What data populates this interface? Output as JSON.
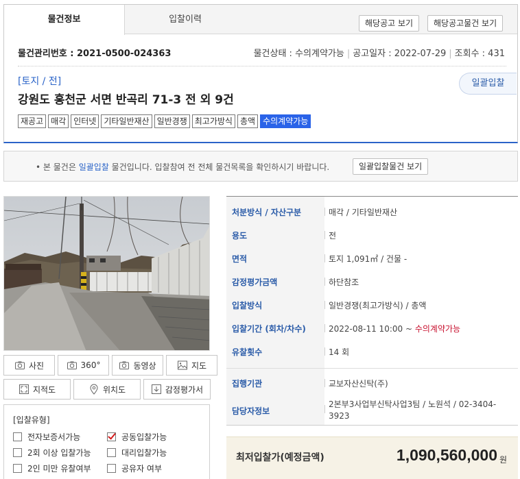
{
  "tabs": [
    {
      "label": "물건정보",
      "active": true
    },
    {
      "label": "입찰이력",
      "active": false
    }
  ],
  "header_buttons": {
    "notice_view": "해당공고 보기",
    "notice_items_view": "해당공고물건 보기"
  },
  "info": {
    "mgmt_number": "물건관리번호 : 2021-0500-024363",
    "status": "물건상태 : 수의계약가능",
    "notice_date": "공고일자 : 2022-07-29",
    "views": "조회수 : 431"
  },
  "category": "[토지 / 전]",
  "address": "강원도 홍천군 서면 반곡리 71-3 전 외 9건",
  "bulk_pill": "일괄입찰",
  "tags": [
    "재공고",
    "매각",
    "인터넷",
    "기타일반재산",
    "일반경쟁",
    "최고가방식",
    "총액",
    "수의계약가능"
  ],
  "highlight_tag": "수의계약가능",
  "notice": {
    "prefix": "• 본 물건은 ",
    "link": "일괄입찰",
    "suffix": " 물건입니다. 입찰참여 전 전체 물건목록을 확인하시기 바랍니다.",
    "button": "일괄입찰물건 보기"
  },
  "tools": {
    "photo": "사진",
    "view360": "360°",
    "video": "동영상",
    "map": "지도",
    "cadastral": "지적도",
    "location": "위치도",
    "appraisal": "감정평가서"
  },
  "bid_type": {
    "title": "[입찰유형]",
    "items": [
      {
        "label": "전자보증서가능",
        "checked": false
      },
      {
        "label": "공동입찰가능",
        "checked": true
      },
      {
        "label": "2회 이상 입찰가능",
        "checked": false
      },
      {
        "label": "대리입찰가능",
        "checked": false
      },
      {
        "label": "2인 미만 유찰여부",
        "checked": false
      },
      {
        "label": "공유자 여부",
        "checked": false
      }
    ]
  },
  "details": [
    {
      "label": "처분방식 / 자산구분",
      "value": "매각 / 기타일반재산"
    },
    {
      "label": "용도",
      "value": "전"
    },
    {
      "label": "면적",
      "value": "토지 1,091㎡ / 건물 -"
    },
    {
      "label": "감정평가금액",
      "value": "하단참조"
    },
    {
      "label": "입찰방식",
      "value": "일반경쟁(최고가방식) / 총액"
    },
    {
      "label": "입찰기간 (회차/차수)",
      "value": "2022-08-11 10:00 ~ ",
      "value_red": "수의계약가능"
    },
    {
      "label": "유찰횟수",
      "value": "14 회"
    },
    {
      "label": "집행기관",
      "value": "교보자산신탁(주)"
    },
    {
      "label": "담당자정보",
      "value": "2본부3사업부신탁사업3팀 / 노원석 / 02-3404-3923"
    }
  ],
  "price": {
    "label": "최저입찰가(예정금액)",
    "value": "1,090,560,000",
    "unit": "원"
  },
  "colors": {
    "accent": "#2a63c8",
    "highlight_tag": "#2a63e8",
    "red": "#c8102e"
  }
}
